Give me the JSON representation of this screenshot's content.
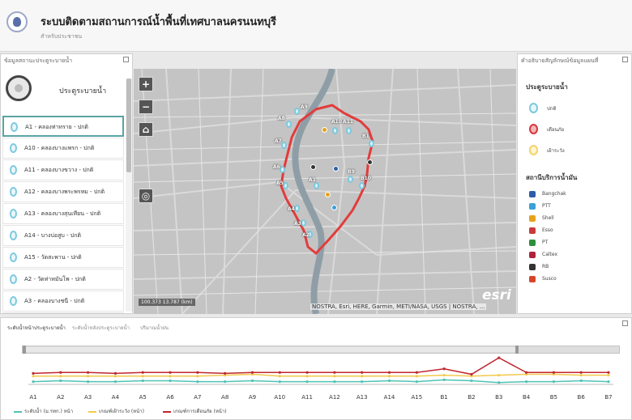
{
  "header": {
    "title": "ระบบติดตามสถานการณ์น้ำพื้นที่เทศบาลนครนนทบุรี",
    "subtitle": "สำหรับประชาชน"
  },
  "left_panel": {
    "title": "ข้อมูลสถานะประตูระบายน้ำ",
    "header_label": "ประตูระบายน้ำ",
    "items": [
      {
        "label": "A1 - คลองท่าทราย - ปกติ"
      },
      {
        "label": "A10 - คลองบางแพรก - ปกติ"
      },
      {
        "label": "A11 - คลองบางขวาง - ปกติ"
      },
      {
        "label": "A12 - คลองบางพระพรหม - ปกติ"
      },
      {
        "label": "A13 - คลองบางสุนเทียน - ปกติ"
      },
      {
        "label": "A14 - บางบ่อสูบ - ปกติ"
      },
      {
        "label": "A15 - วัดสะพาน - ปกติ"
      },
      {
        "label": "A2 - วัดท่าหมันโพ - ปกติ"
      },
      {
        "label": "A3 - คลองบางชนี - ปกติ"
      },
      {
        "label": "A4 - คลองอ้อมช้าง - ปกติ"
      }
    ]
  },
  "map": {
    "zoom_in": "+",
    "zoom_out": "−",
    "home": "⌂",
    "locate": "◎",
    "scale": "100.373 13.787 (km)",
    "attribution": "NOSTRA, Esri, HERE, Garmin, METI/NASA, USGS | NOSTRA, ...",
    "esri": "esri",
    "labels": [
      "A9",
      "A8",
      "A7",
      "A6",
      "A5",
      "A4",
      "A3",
      "A2",
      "A1",
      "A10",
      "A11",
      "A12",
      "A13",
      "A14",
      "A15",
      "B1",
      "B2",
      "B3",
      "B4",
      "B5",
      "B6",
      "B7",
      "B8",
      "B9",
      "B10",
      "B11",
      "B12"
    ]
  },
  "right_panel": {
    "title": "คำอธิบายสัญลักษณ์ข้อมูลแผนที่",
    "gate_heading": "ประตูระบายน้ำ",
    "gate_legend": [
      {
        "label": "ปกติ",
        "color": "#7cc8de",
        "fill": "#e9f7fb"
      },
      {
        "label": "เตือนภัย",
        "color": "#d9363e",
        "fill": "#f4b6b6"
      },
      {
        "label": "เฝ้าระวัง",
        "color": "#f4d36a",
        "fill": "#fff6d2"
      }
    ],
    "fuel_heading": "สถานีบริการน้ำมัน",
    "fuel_legend": [
      {
        "label": "Bangchak",
        "color": "#2a5fa8"
      },
      {
        "label": "PTT",
        "color": "#3aa0d8"
      },
      {
        "label": "Shell",
        "color": "#e6a21a"
      },
      {
        "label": "Esso",
        "color": "#c93a3a"
      },
      {
        "label": "PT",
        "color": "#2d8f3a"
      },
      {
        "label": "Caltex",
        "color": "#b0223a"
      },
      {
        "label": "RB",
        "color": "#333333"
      },
      {
        "label": "Susco",
        "color": "#d6452a"
      }
    ]
  },
  "bottom_panel": {
    "tabs": [
      {
        "label": "ระดับน้ำหน้าประตูระบายน้ำ"
      },
      {
        "label": "ระดับน้ำหลังประตูระบายน้ำ"
      },
      {
        "label": "ปริมาณน้ำฝน"
      }
    ]
  },
  "chart_data": {
    "type": "line",
    "categories": [
      "A1",
      "A2",
      "A3",
      "A4",
      "A5",
      "A6",
      "A7",
      "A8",
      "A9",
      "A10",
      "A11",
      "A12",
      "A13",
      "A14",
      "A15",
      "B1",
      "B2",
      "B3",
      "B4",
      "B5",
      "B6",
      "B7"
    ],
    "series": [
      {
        "name": "ระดับน้ำ (ม.รทก.) หน้า",
        "color": "#4fc3b5",
        "values": [
          0.3,
          0.4,
          0.3,
          0.3,
          0.4,
          0.4,
          0.3,
          0.3,
          0.4,
          0.3,
          0.3,
          0.3,
          0.3,
          0.4,
          0.3,
          0.5,
          0.4,
          0.2,
          0.3,
          0.3,
          0.4,
          0.3
        ]
      },
      {
        "name": "เกณฑ์เฝ้าระวัง (หน้า)",
        "color": "#f2c94c",
        "values": [
          0.9,
          0.9,
          0.9,
          0.9,
          0.9,
          0.9,
          0.9,
          1.0,
          1.1,
          0.9,
          0.9,
          0.9,
          0.9,
          0.9,
          0.9,
          1.0,
          0.9,
          1.0,
          1.1,
          1.1,
          1.0,
          1.0
        ]
      },
      {
        "name": "เกณฑ์การเตือนภัย (หน้า)",
        "color": "#c0262d",
        "values": [
          1.2,
          1.3,
          1.3,
          1.2,
          1.3,
          1.3,
          1.3,
          1.2,
          1.3,
          1.3,
          1.3,
          1.3,
          1.3,
          1.3,
          1.3,
          1.7,
          1.1,
          2.9,
          1.3,
          1.3,
          1.3,
          1.3
        ]
      }
    ]
  }
}
